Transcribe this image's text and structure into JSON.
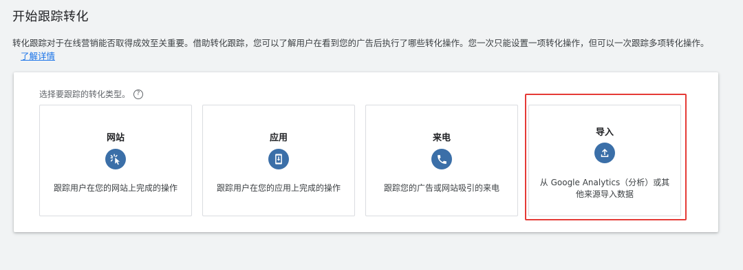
{
  "header": {
    "title": "开始跟踪转化"
  },
  "intro": {
    "text": "转化跟踪对于在线营销能否取得成效至关重要。借助转化跟踪，您可以了解用户在看到您的广告后执行了哪些转化操作。您一次只能设置一项转化操作，但可以一次跟踪多项转化操作。",
    "link_label": "了解详情"
  },
  "selector": {
    "prompt": "选择要跟踪的转化类型。",
    "help_icon": "question-circle-icon"
  },
  "options": [
    {
      "title": "网站",
      "icon": "click-cursor-icon",
      "description": "跟踪用户在您的网站上完成的操作"
    },
    {
      "title": "应用",
      "icon": "mobile-download-icon",
      "description": "跟踪用户在您的应用上完成的操作"
    },
    {
      "title": "来电",
      "icon": "phone-icon",
      "description": "跟踪您的广告或网站吸引的来电"
    },
    {
      "title": "导入",
      "icon": "upload-icon",
      "description": "从 Google Analytics（分析）或其他来源导入数据"
    }
  ],
  "colors": {
    "icon_circle": "#3b6fa8",
    "link": "#1a73e8",
    "highlight": "#e53935"
  }
}
